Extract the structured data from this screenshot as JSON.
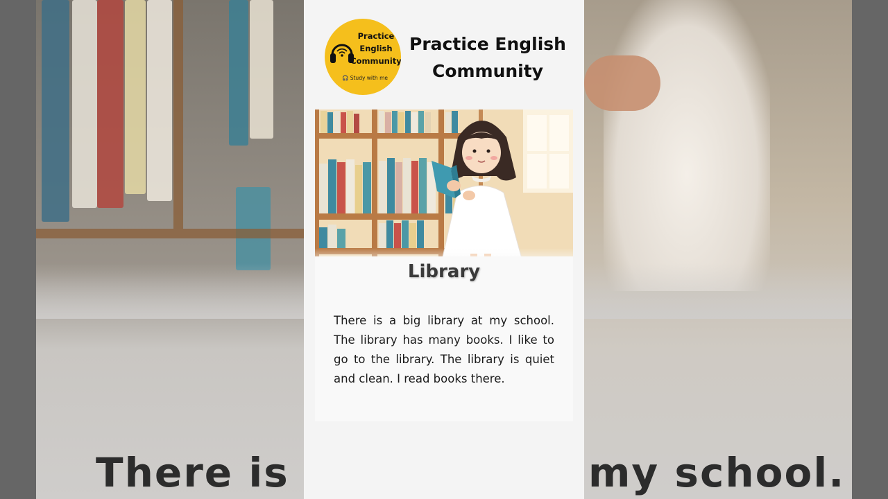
{
  "logo": {
    "lines": [
      "Practice",
      "English",
      "Community"
    ],
    "tagline": "Study with me",
    "icon": "headphones-icon"
  },
  "brand": {
    "title_line1": "Practice English",
    "title_line2": "Community"
  },
  "story": {
    "title": "Library",
    "text": "There is a big library at my school. The library has many books. I like to go to the library. The library is quiet and clean. I read books there."
  },
  "background_caption": {
    "left_fragment": "There is a",
    "right_fragment": "my school."
  },
  "colors": {
    "logo_yellow": "#f5bf1c",
    "card_background": "#f4f4f4",
    "shelf_wood": "#b97a45"
  }
}
